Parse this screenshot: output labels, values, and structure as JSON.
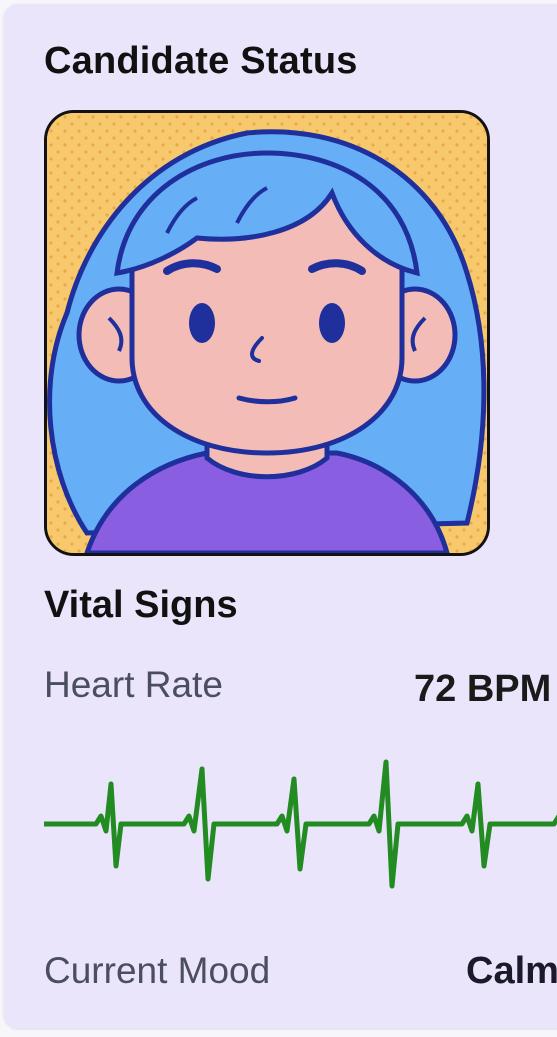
{
  "card": {
    "title": "Candidate Status"
  },
  "avatar": {
    "icon": "cartoon-character-portrait",
    "colors": {
      "background": "#f7c96c",
      "hair": "#66aef6",
      "skin": "#f4bcb6",
      "shirt": "#8a5ee0",
      "outline": "#1f2f9c"
    }
  },
  "vitals": {
    "title": "Vital Signs",
    "heart_rate_label": "Heart Rate",
    "heart_rate_value": "72 BPM",
    "ecg_color": "#228b22",
    "mood_label": "Current Mood",
    "mood_value": "Calm"
  }
}
